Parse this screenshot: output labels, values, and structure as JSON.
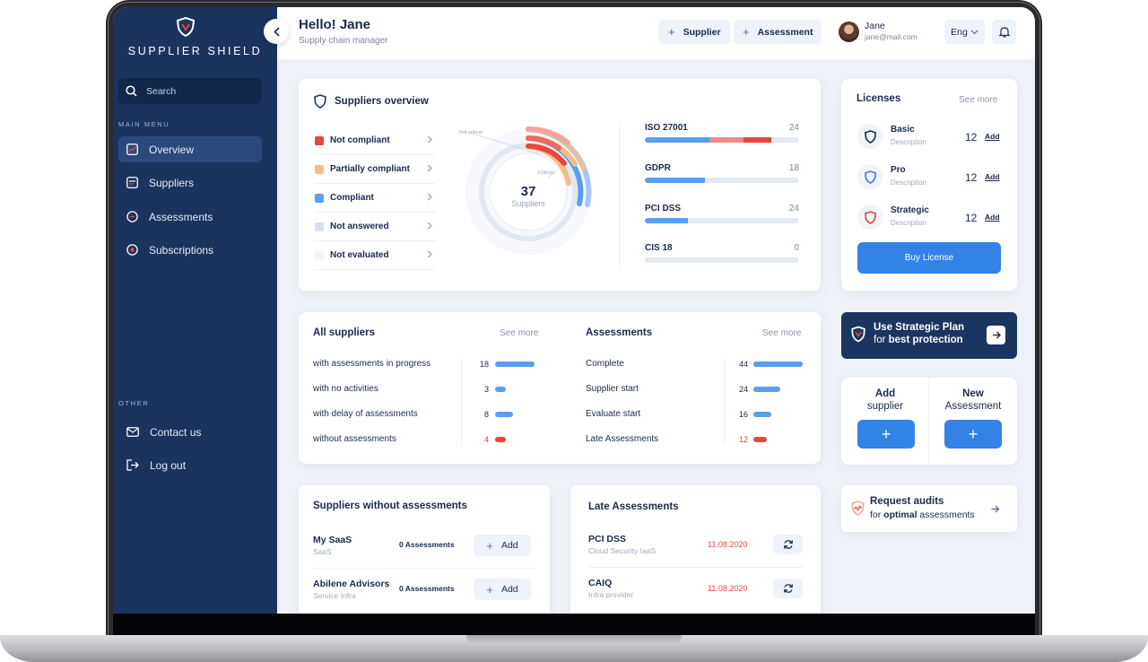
{
  "app": {
    "brand": "SUPPLIER SHIELD"
  },
  "sidebar": {
    "search_placeholder": "Search",
    "main_menu_label": "MAIN MENU",
    "other_label": "OTHER",
    "items": [
      {
        "label": "Overview",
        "icon": "chart-icon",
        "active": true
      },
      {
        "label": "Suppliers",
        "icon": "suppliers-icon"
      },
      {
        "label": "Assessments",
        "icon": "assessments-icon"
      },
      {
        "label": "Subscriptions",
        "icon": "subscriptions-icon"
      }
    ],
    "other_items": [
      {
        "label": "Contact us",
        "icon": "mail-icon"
      },
      {
        "label": "Log out",
        "icon": "logout-icon"
      }
    ]
  },
  "header": {
    "greeting": "Hello! Jane",
    "role": "Supply chain manager",
    "btn_supplier": "Supplier",
    "btn_assessment": "Assessment",
    "user_name": "Jane",
    "user_email": "jane@mail.com",
    "language": "Eng"
  },
  "overview": {
    "title": "Suppliers overview",
    "legend": [
      {
        "label": "Not compliant",
        "color": "#e8473c"
      },
      {
        "label": "Partially compliant",
        "color": "#f5bd8c"
      },
      {
        "label": "Compliant",
        "color": "#5a9ef0"
      },
      {
        "label": "Not answered",
        "color": "#d7e0ee"
      },
      {
        "label": "Not evaluated",
        "color": "#f2f4f8"
      }
    ],
    "donut_total": "37",
    "donut_label": "Suppliers",
    "label_not_critical": "Not critical",
    "label_critical": "Critical",
    "standards": [
      {
        "name": "ISO 27001",
        "count": "24",
        "blue": 0.42,
        "pink": 0.22,
        "red": 0.18
      },
      {
        "name": "GDPR",
        "count": "18",
        "blue": 0.39,
        "pink": 0,
        "red": 0
      },
      {
        "name": "PCI DSS",
        "count": "24",
        "blue": 0.28,
        "pink": 0,
        "red": 0
      },
      {
        "name": "CIS 18",
        "count": "0",
        "blue": 0,
        "pink": 0,
        "red": 0
      }
    ]
  },
  "all_suppliers": {
    "title": "All suppliers",
    "see_more": "See more",
    "rows": [
      {
        "label": "with assessments in progress",
        "count": "18",
        "value": 18,
        "color": "#5a9ef0"
      },
      {
        "label": "with no activities",
        "count": "3",
        "value": 3,
        "color": "#5a9ef0"
      },
      {
        "label": "with delay of assessments",
        "count": "8",
        "value": 8,
        "color": "#5a9ef0"
      },
      {
        "label": "without assessments",
        "count": "4",
        "value": 4,
        "color": "#e8473c"
      }
    ]
  },
  "assessments": {
    "title": "Assessments",
    "see_more": "See more",
    "rows": [
      {
        "label": "Complete",
        "count": "44",
        "value": 44,
        "color": "#5a9ef0"
      },
      {
        "label": "Supplier start",
        "count": "24",
        "value": 24,
        "color": "#5a9ef0"
      },
      {
        "label": "Evaluate start",
        "count": "16",
        "value": 16,
        "color": "#5a9ef0"
      },
      {
        "label": "Late Assessments",
        "count": "12",
        "value": 12,
        "color": "#e8473c"
      }
    ]
  },
  "licenses": {
    "title": "Licenses",
    "see_more": "See more",
    "items": [
      {
        "name": "Basic",
        "desc": "Description",
        "count": "12",
        "add": "Add",
        "color": "#1b345e"
      },
      {
        "name": "Pro",
        "desc": "Description",
        "count": "12",
        "add": "Add",
        "color": "#3383e6"
      },
      {
        "name": "Strategic",
        "desc": "Description",
        "count": "12",
        "add": "Add",
        "color": "#e8473c"
      }
    ],
    "buy": "Buy License"
  },
  "plan": {
    "line1": "Use Strategic Plan",
    "line2_prefix": "for ",
    "line2_bold": "best protection"
  },
  "quick": {
    "add_supplier_l1": "Add",
    "add_supplier_l2": "supplier",
    "new_assessment_l1": "New",
    "new_assessment_l2": "Assessment"
  },
  "audit": {
    "line1": "Request audits",
    "line2_prefix": "for ",
    "line2_bold": "optimal",
    "line2_suffix": " assessments"
  },
  "suppliers_without": {
    "title": "Suppliers without assessments",
    "rows": [
      {
        "name": "My SaaS",
        "sub": "SaaS",
        "count": "0 Assessments",
        "action": "Add"
      },
      {
        "name": "Abilene Advisors",
        "sub": "Service Infra",
        "count": "0 Assessments",
        "action": "Add"
      }
    ]
  },
  "late_assessments": {
    "title": "Late Assessments",
    "rows": [
      {
        "name": "PCI DSS",
        "sub": "Cloud Security IaaS",
        "date": "11.08.2020"
      },
      {
        "name": "CAIQ",
        "sub": "Infra provider",
        "date": "11.08.2020"
      }
    ]
  }
}
